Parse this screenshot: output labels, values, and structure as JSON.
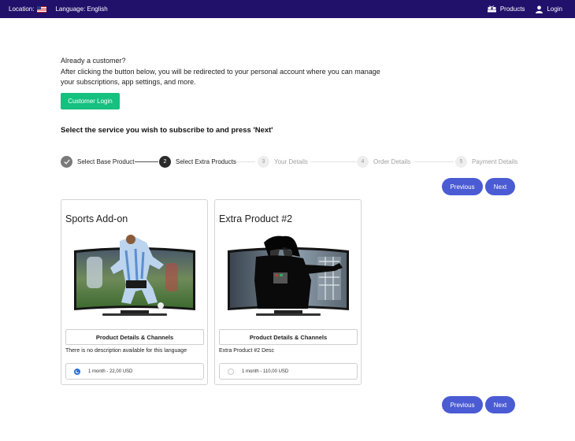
{
  "topbar": {
    "location_label": "Location:",
    "language_label": "Language: English",
    "products_label": "Products",
    "login_label": "Login"
  },
  "intro": {
    "line1": "Already a customer?",
    "line2": "After clicking the button below, you will be redirected to your personal account where you can manage your subscriptions, app settings, and more."
  },
  "customer_login_label": "Customer Login",
  "instruction": "Select the service you wish to subscribe to and press 'Next'",
  "steps": [
    {
      "number": "",
      "label": "Select Base Product",
      "state": "done"
    },
    {
      "number": "2",
      "label": "Select Extra Products",
      "state": "active"
    },
    {
      "number": "3",
      "label": "Your Details",
      "state": "future"
    },
    {
      "number": "4",
      "label": "Order Details",
      "state": "future"
    },
    {
      "number": "5",
      "label": "Payment Details",
      "state": "future"
    }
  ],
  "nav": {
    "previous_label": "Previous",
    "next_label": "Next"
  },
  "products": [
    {
      "title": "Sports Add-on",
      "details_label": "Product Details & Channels",
      "description": "There is no description available for this language",
      "option_label": "1 month - 22,00 USD",
      "option_selected": true
    },
    {
      "title": "Extra Product #2",
      "details_label": "Product Details & Channels",
      "description": "Extra Product #2 Desc",
      "option_label": "1 month - 110,00 USD",
      "option_selected": false
    }
  ],
  "colors": {
    "topbar": "#22116b",
    "login_button": "#16c07f",
    "nav_button": "#4a5bd4",
    "radio_selected": "#2b6fd6"
  },
  "icons": {
    "flag": "us-flag-icon",
    "products": "boxes-icon",
    "login": "user-icon",
    "step_done": "checkmark-icon"
  }
}
